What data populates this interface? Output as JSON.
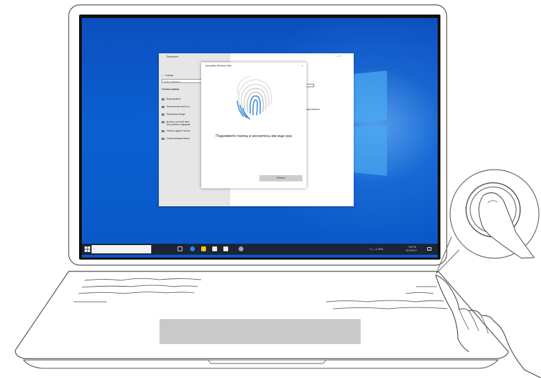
{
  "settings_window": {
    "title": "Параметры",
    "home": "Главная",
    "search_placeholder": "Найти параметр",
    "section": "Учетные записи",
    "nav": [
      "Ваши данные",
      "Электронная почта и у",
      "Параметры входа",
      "Доступ к учетной запи",
      "или учебного заведени",
      "Семья и другие пользо",
      "Синхронизация ваших"
    ],
    "right_text": "ения, осуществления",
    "add_button": "Добавить"
  },
  "dialog": {
    "title": "Настройка Windows Hello",
    "close": "×",
    "message": "Поднимите палец и коснитесь им еще раз",
    "stop_button": "Отмена"
  },
  "taskbar": {
    "search_icon": "search-icon",
    "tray_text": "^  ♦₀  ⊿  ⊡  ENG",
    "clock_time": "7:55 PM",
    "clock_date": "11/11/2019"
  },
  "colors": {
    "desktop": "#0b5fd1",
    "taskbar": "#1c2535",
    "accent": "#3d8bd8",
    "touchpad": "#c9c9c9"
  }
}
